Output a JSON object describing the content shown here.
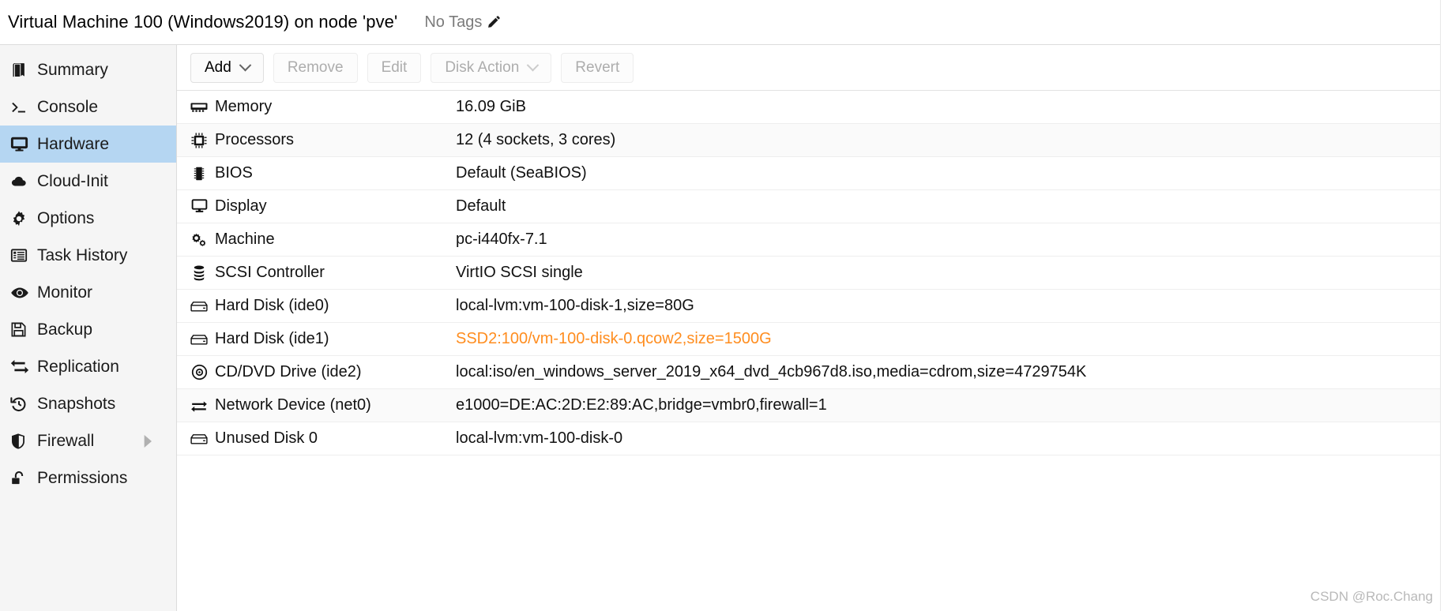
{
  "header": {
    "title": "Virtual Machine 100 (Windows2019) on node 'pve'",
    "tags_label": "No Tags",
    "edit_tags_icon": "pencil-icon"
  },
  "sidebar": {
    "items": [
      {
        "label": "Summary",
        "icon": "book-icon",
        "selected": false,
        "has_submenu": false
      },
      {
        "label": "Console",
        "icon": "terminal-icon",
        "selected": false,
        "has_submenu": false
      },
      {
        "label": "Hardware",
        "icon": "monitor-icon",
        "selected": true,
        "has_submenu": false
      },
      {
        "label": "Cloud-Init",
        "icon": "cloud-icon",
        "selected": false,
        "has_submenu": false
      },
      {
        "label": "Options",
        "icon": "gear-icon",
        "selected": false,
        "has_submenu": false
      },
      {
        "label": "Task History",
        "icon": "list-icon",
        "selected": false,
        "has_submenu": false
      },
      {
        "label": "Monitor",
        "icon": "eye-icon",
        "selected": false,
        "has_submenu": false
      },
      {
        "label": "Backup",
        "icon": "floppy-disk-icon",
        "selected": false,
        "has_submenu": false
      },
      {
        "label": "Replication",
        "icon": "sync-arrows-icon",
        "selected": false,
        "has_submenu": false
      },
      {
        "label": "Snapshots",
        "icon": "history-icon",
        "selected": false,
        "has_submenu": false
      },
      {
        "label": "Firewall",
        "icon": "shield-icon",
        "selected": false,
        "has_submenu": true
      },
      {
        "label": "Permissions",
        "icon": "unlock-icon",
        "selected": false,
        "has_submenu": false
      }
    ]
  },
  "toolbar": {
    "buttons": [
      {
        "label": "Add",
        "disabled": false,
        "has_caret": true
      },
      {
        "label": "Remove",
        "disabled": true,
        "has_caret": false
      },
      {
        "label": "Edit",
        "disabled": true,
        "has_caret": false
      },
      {
        "label": "Disk Action",
        "disabled": true,
        "has_caret": true
      },
      {
        "label": "Revert",
        "disabled": true,
        "has_caret": false
      }
    ]
  },
  "hardware_table": {
    "rows": [
      {
        "icon": "memory-icon",
        "key": "Memory",
        "value": "16.09 GiB",
        "pending": false
      },
      {
        "icon": "cpu-icon",
        "key": "Processors",
        "value": "12 (4 sockets, 3 cores)",
        "pending": false
      },
      {
        "icon": "chip-icon",
        "key": "BIOS",
        "value": "Default (SeaBIOS)",
        "pending": false
      },
      {
        "icon": "monitor-icon",
        "key": "Display",
        "value": "Default",
        "pending": false
      },
      {
        "icon": "cogs-icon",
        "key": "Machine",
        "value": "pc-i440fx-7.1",
        "pending": false
      },
      {
        "icon": "database-icon",
        "key": "SCSI Controller",
        "value": "VirtIO SCSI single",
        "pending": false
      },
      {
        "icon": "hard-disk-icon",
        "key": "Hard Disk (ide0)",
        "value": "local-lvm:vm-100-disk-1,size=80G",
        "pending": false
      },
      {
        "icon": "hard-disk-icon",
        "key": "Hard Disk (ide1)",
        "value": "SSD2:100/vm-100-disk-0.qcow2,size=1500G",
        "pending": true
      },
      {
        "icon": "cd-drive-icon",
        "key": "CD/DVD Drive (ide2)",
        "value": "local:iso/en_windows_server_2019_x64_dvd_4cb967d8.iso,media=cdrom,size=4729754K",
        "pending": false
      },
      {
        "icon": "network-icon",
        "key": "Network Device (net0)",
        "value": "e1000=DE:AC:2D:E2:89:AC,bridge=vmbr0,firewall=1",
        "pending": false
      },
      {
        "icon": "hard-disk-icon",
        "key": "Unused Disk 0",
        "value": "local-lvm:vm-100-disk-0",
        "pending": false
      }
    ]
  },
  "watermark": {
    "text": "CSDN @Roc.Chang"
  },
  "colors": {
    "selection": "#b5d6f2",
    "pending_value": "#ff8d1f",
    "sidebar_bg": "#f5f5f5",
    "text": "#111111",
    "muted_text": "#adadad"
  }
}
